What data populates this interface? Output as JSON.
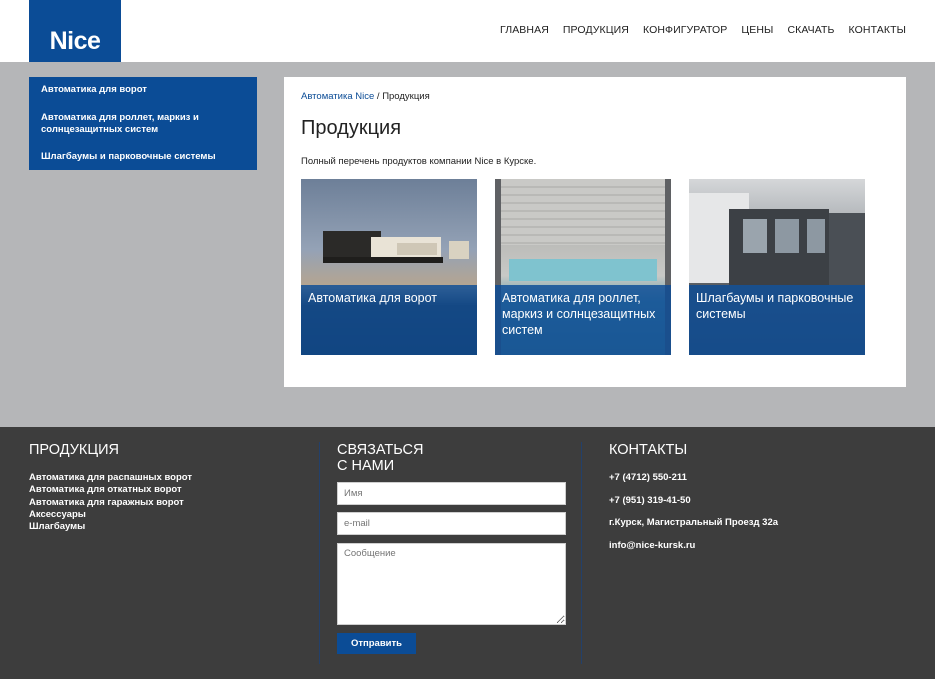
{
  "header": {
    "logo": "Nice",
    "nav": [
      "ГЛАВНАЯ",
      "ПРОДУКЦИЯ",
      "КОНФИГУРАТОР",
      "ЦЕНЫ",
      "СКАЧАТЬ",
      "КОНТАКТЫ"
    ]
  },
  "sidebar": {
    "items": [
      "Автоматика для ворот",
      "Автоматика для роллет, маркиз и солнцезащитных систем",
      "Шлагбаумы и парковочные системы"
    ]
  },
  "main": {
    "breadcrumb": {
      "link": "Автоматика Nice",
      "separator": " / ",
      "current": "Продукция"
    },
    "title": "Продукция",
    "intro": "Полный перечень продуктов компании Nice в Курске.",
    "cards": [
      {
        "caption": "Автоматика для ворот"
      },
      {
        "caption": "Автоматика для роллет, маркиз и солнцезащитных систем"
      },
      {
        "caption": "Шлагбаумы и парковочные системы"
      }
    ]
  },
  "footer": {
    "products": {
      "heading": "ПРОДУКЦИЯ",
      "links": [
        "Автоматика для распашных ворот",
        "Автоматика для откатных ворот",
        "Автоматика для гаражных ворот",
        "Аксессуары",
        "Шлагбаумы"
      ]
    },
    "contact_form": {
      "heading": "СВЯЗАТЬСЯ С НАМИ",
      "name_placeholder": "Имя",
      "email_placeholder": "e-mail",
      "message_placeholder": "Сообщение",
      "submit_label": "Отправить"
    },
    "contacts": {
      "heading": "КОНТАКТЫ",
      "phone1": "+7 (4712) 550-211",
      "phone2": "+7 (951) 319-41-50",
      "address": "г.Курск, Магистральный Проезд 32а",
      "email": "info@nice-kursk.ru"
    }
  },
  "colors": {
    "brand_blue": "#0b4c96",
    "band_gray": "#b5b6b8",
    "footer_bg": "#3d3d3d"
  }
}
